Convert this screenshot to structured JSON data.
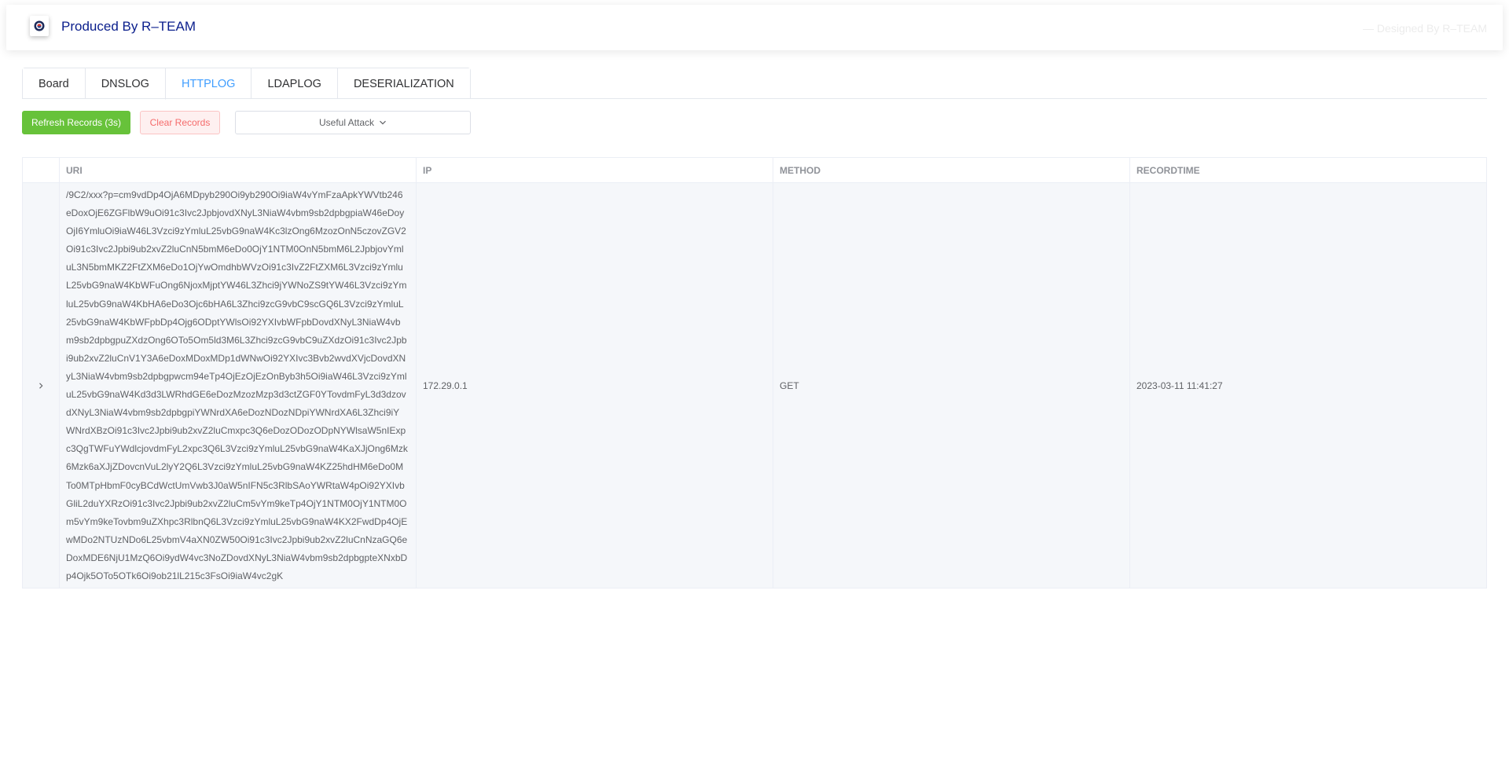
{
  "header": {
    "brand_title": "Produced By R–TEAM",
    "designed_by": "— Designed By R–TEAM"
  },
  "tabs": [
    {
      "label": "Board",
      "active": false
    },
    {
      "label": "DNSLOG",
      "active": false
    },
    {
      "label": "HTTPLOG",
      "active": true
    },
    {
      "label": "LDAPLOG",
      "active": false
    },
    {
      "label": "DESERIALIZATION",
      "active": false
    }
  ],
  "toolbar": {
    "refresh_label": "Refresh Records (3s)",
    "clear_label": "Clear Records",
    "useful_attack_label": "Useful Attack"
  },
  "table": {
    "columns": [
      "",
      "URI",
      "IP",
      "METHOD",
      "RECORDTIME"
    ],
    "rows": [
      {
        "uri": "/9C2/xxx?p=cm9vdDp4OjA6MDpyb290Oi9yb290Oi9iaW4vYmFzaApkYWVtb246eDoxOjE6ZGFlbW9uOi91c3Ivc2JpbjovdXNyL3NiaW4vbm9sb2dpbgpiaW46eDoyOjI6YmluOi9iaW46L3Vzci9zYmluL25vbG9naW4Kc3lzOng6MzozOnN5czovZGV2Oi91c3Ivc2Jpbi9ub2xvZ2luCnN5bmM6eDo0OjY1NTM0OnN5bmM6L2JpbjovYmluL3N5bmMKZ2FtZXM6eDo1OjYwOmdhbWVzOi91c3IvZ2FtZXM6L3Vzci9zYmluL25vbG9naW4KbWFuOng6NjoxMjptYW46L3Zhci9jYWNoZS9tYW46L3Vzci9zYmluL25vbG9naW4KbHA6eDo3Ojc6bHA6L3Zhci9zcG9vbC9scGQ6L3Vzci9zYmluL25vbG9naW4KbWFpbDp4Ojg6ODptYWlsOi92YXIvbWFpbDovdXNyL3NiaW4vbm9sb2dpbgpuZXdzOng6OTo5Om5ld3M6L3Zhci9zcG9vbC9uZXdzOi91c3Ivc2Jpbi9ub2xvZ2luCnV1Y3A6eDoxMDoxMDp1dWNwOi92YXIvc3Bvb2wvdXVjcDovdXNyL3NiaW4vbm9sb2dpbgpwcm94eTp4OjEzOjEzOnByb3h5Oi9iaW46L3Vzci9zYmluL25vbG9naW4Kd3d3LWRhdGE6eDozMzozMzp3d3ctZGF0YTovdmFyL3d3dzovdXNyL3NiaW4vbm9sb2dpbgpiYWNrdXA6eDozNDozNDpiYWNrdXA6L3Zhci9iYWNrdXBzOi91c3Ivc2Jpbi9ub2xvZ2luCmxpc3Q6eDozODozODpNYWlsaW5nIExpc3QgTWFuYWdlcjovdmFyL2xpc3Q6L3Vzci9zYmluL25vbG9naW4KaXJjOng6Mzk6Mzk6aXJjZDovcnVuL2lyY2Q6L3Vzci9zYmluL25vbG9naW4KZ25hdHM6eDo0MTo0MTpHbmF0cyBCdWctUmVwb3J0aW5nIFN5c3RlbSAoYWRtaW4pOi92YXIvbGliL2duYXRzOi91c3Ivc2Jpbi9ub2xvZ2luCm5vYm9keTp4OjY1NTM0OjY1NTM0Om5vYm9keTovbm9uZXhpc3RlbnQ6L3Vzci9zYmluL25vbG9naW4KX2FwdDp4OjEwMDo2NTUzNDo6L25vbmV4aXN0ZW50Oi91c3Ivc2Jpbi9ub2xvZ2luCnNzaGQ6eDoxMDE6NjU1MzQ6Oi9ydW4vc3NoZDovdXNyL3NiaW4vbm9sb2dpbgpteXNxbDp4Ojk5OTo5OTk6Oi9ob21lL215c3FsOi9iaW4vc2gK",
        "ip": "172.29.0.1",
        "method": "GET",
        "recordtime": "2023-03-11 11:41:27"
      }
    ]
  }
}
